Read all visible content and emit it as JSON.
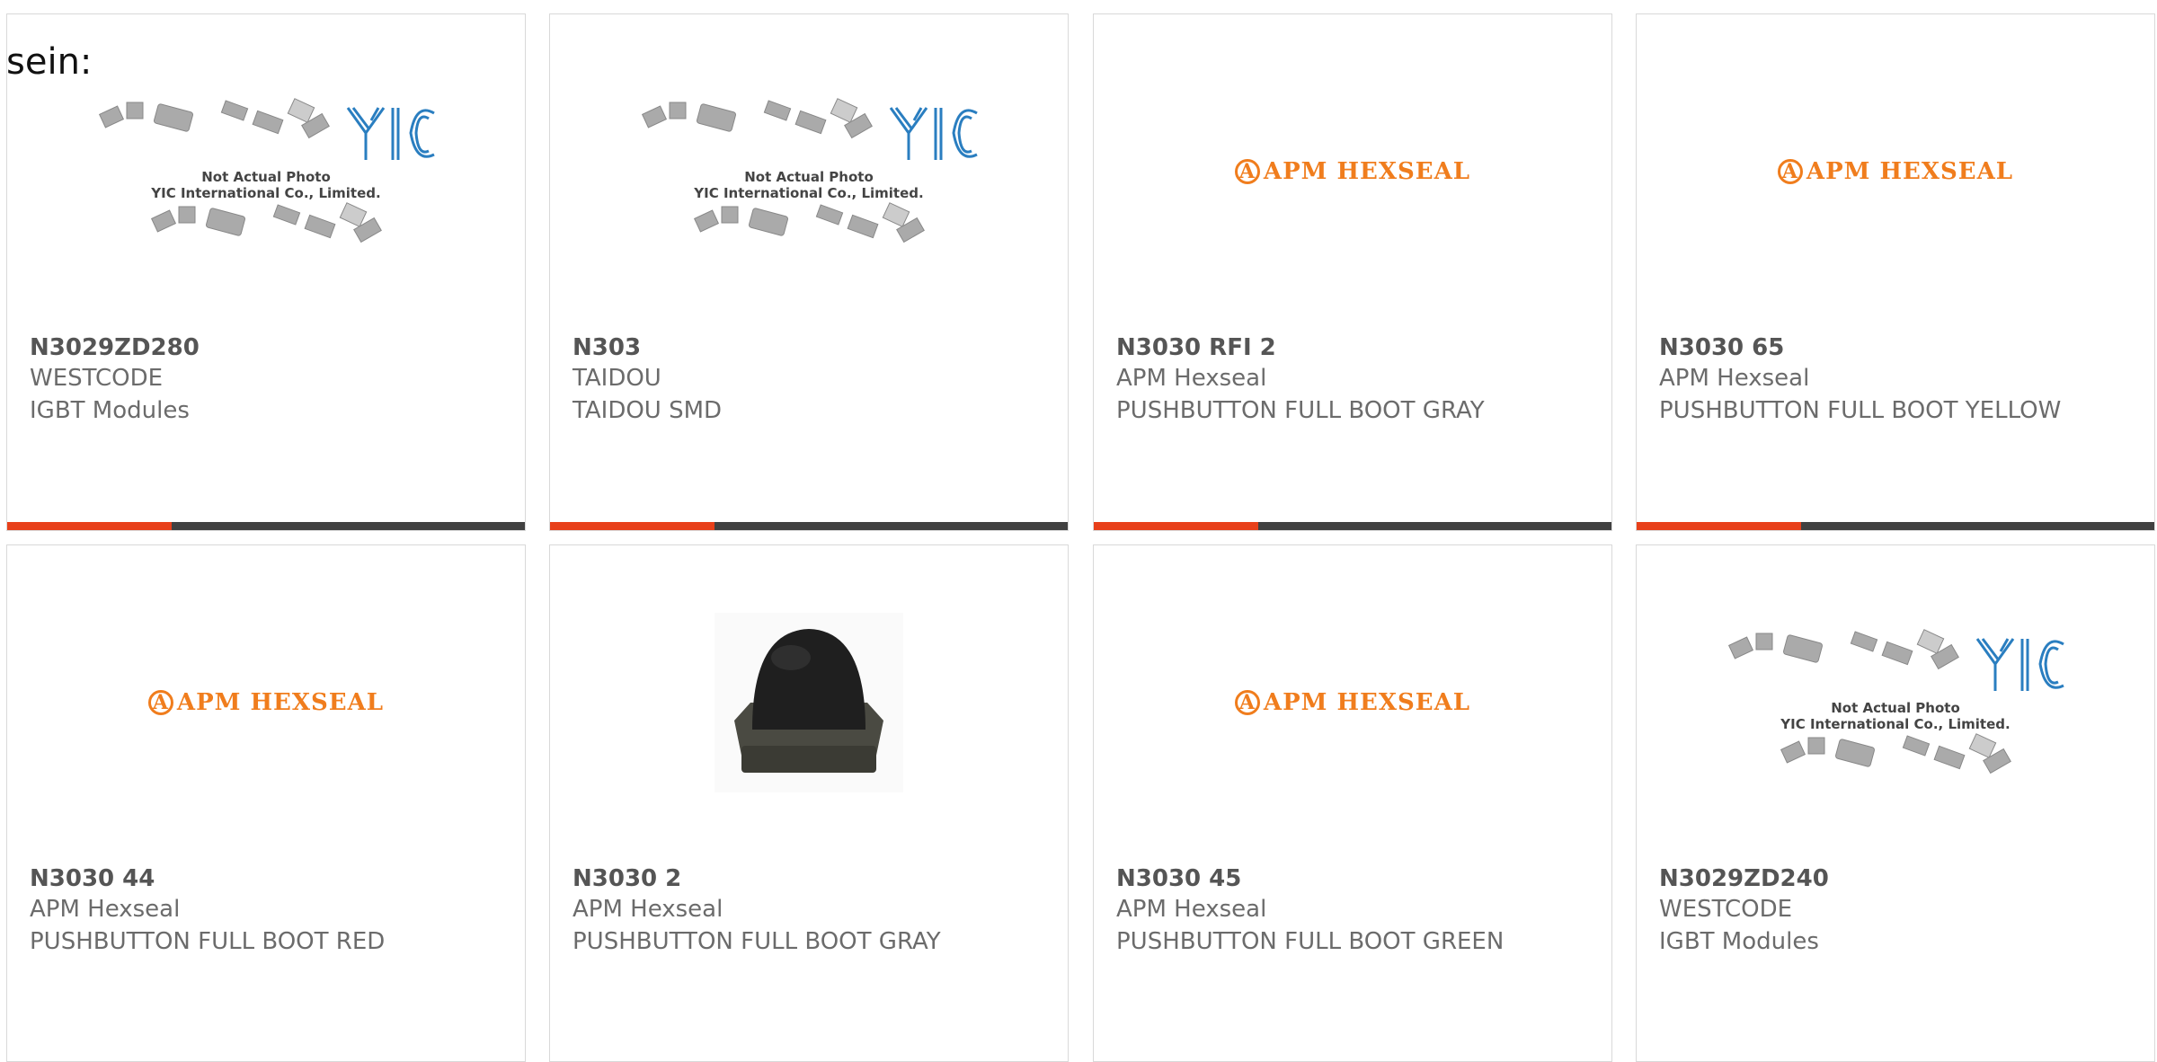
{
  "header": {
    "fragment_text": "sein:"
  },
  "colors": {
    "accent": "#e8401a",
    "bar": "#414141",
    "apm_orange": "#f07d1d",
    "yic_blue": "#2a7ec0"
  },
  "products": [
    {
      "part": "N3029ZD280",
      "manufacturer": "WESTCODE",
      "description": "IGBT Modules",
      "image": "yic-placeholder",
      "caption1": "Not Actual Photo",
      "caption2": "YIC International Co., Limited."
    },
    {
      "part": "N303",
      "manufacturer": "TAIDOU",
      "description": "TAIDOU SMD",
      "image": "yic-placeholder",
      "caption1": "Not Actual Photo",
      "caption2": "YIC International Co., Limited."
    },
    {
      "part": "N3030 RFI 2",
      "manufacturer": "APM Hexseal",
      "description": "PUSHBUTTON FULL BOOT GRAY",
      "image": "apm-logo",
      "logo_text": "APM HEXSEAL"
    },
    {
      "part": "N3030 65",
      "manufacturer": "APM Hexseal",
      "description": "PUSHBUTTON FULL BOOT YELLOW",
      "image": "apm-logo",
      "logo_text": "APM HEXSEAL"
    },
    {
      "part": "N3030 44",
      "manufacturer": "APM Hexseal",
      "description": "PUSHBUTTON FULL BOOT RED",
      "image": "apm-logo",
      "logo_text": "APM HEXSEAL"
    },
    {
      "part": "N3030 2",
      "manufacturer": "APM Hexseal",
      "description": "PUSHBUTTON FULL BOOT GRAY",
      "image": "black-boot-photo"
    },
    {
      "part": "N3030 45",
      "manufacturer": "APM Hexseal",
      "description": "PUSHBUTTON FULL BOOT GREEN",
      "image": "apm-logo",
      "logo_text": "APM HEXSEAL"
    },
    {
      "part": "N3029ZD240",
      "manufacturer": "WESTCODE",
      "description": "IGBT Modules",
      "image": "yic-placeholder",
      "caption1": "Not Actual Photo",
      "caption2": "YIC International Co., Limited."
    }
  ]
}
